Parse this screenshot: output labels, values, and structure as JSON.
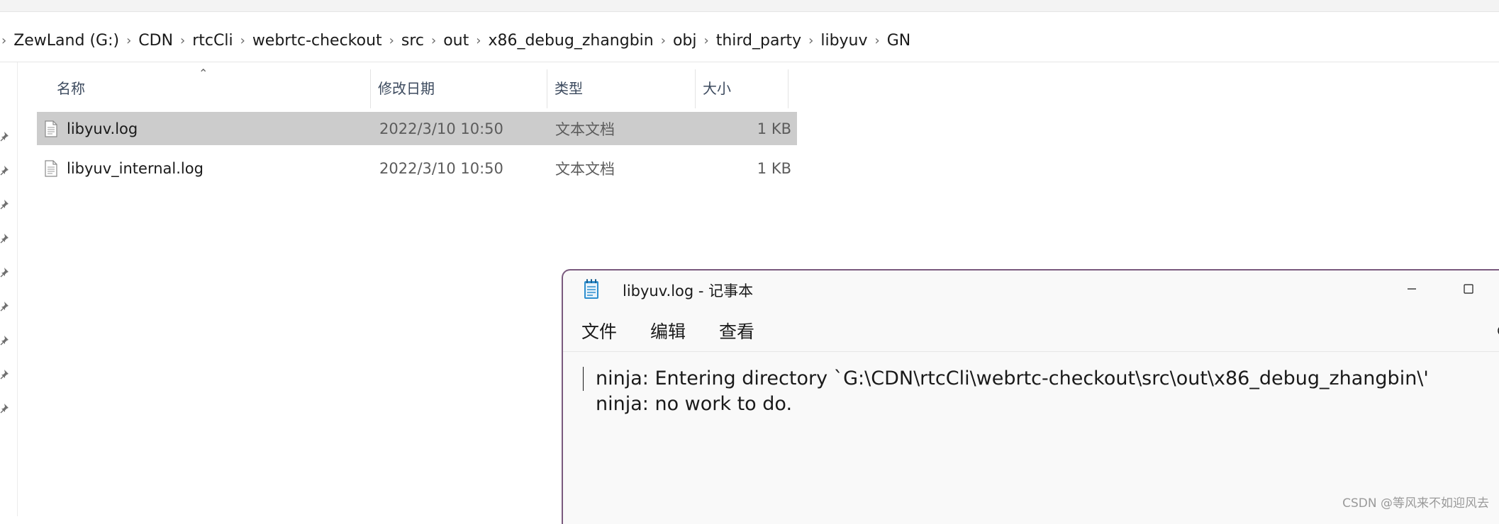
{
  "explorer": {
    "breadcrumb": [
      "ZewLand (G:)",
      "CDN",
      "rtcCli",
      "webrtc-checkout",
      "src",
      "out",
      "x86_debug_zhangbin",
      "obj",
      "third_party",
      "libyuv",
      "GN"
    ],
    "columns": {
      "name": "名称",
      "date": "修改日期",
      "type": "类型",
      "size": "大小"
    },
    "files": [
      {
        "name": "libyuv.log",
        "date": "2022/3/10 10:50",
        "type": "文本文档",
        "size": "1 KB",
        "selected": true
      },
      {
        "name": "libyuv_internal.log",
        "date": "2022/3/10 10:50",
        "type": "文本文档",
        "size": "1 KB",
        "selected": false
      }
    ],
    "pin_icon_count": 9
  },
  "notepad": {
    "title": "libyuv.log - 记事本",
    "menu": [
      "文件",
      "编辑",
      "查看"
    ],
    "lines": [
      "ninja: Entering directory `G:\\CDN\\rtcCli\\webrtc-checkout\\src\\out\\x86_debug_zhangbin\\'",
      "ninja: no work to do."
    ]
  },
  "watermark": "CSDN @等风来不如迎风去",
  "colors": {
    "selection": "#cccccc",
    "notepad_border": "#7a5a7e",
    "notepad_icon": "#2e8fcf"
  }
}
